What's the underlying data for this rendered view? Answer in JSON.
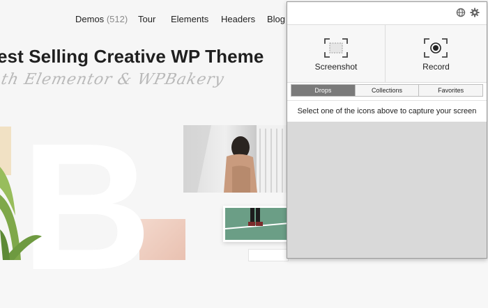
{
  "website": {
    "nav": {
      "demos_label": "Demos",
      "demos_count": "(512)",
      "tour": "Tour",
      "elements": "Elements",
      "headers": "Headers",
      "blog": "Blog"
    },
    "hero": {
      "title": "est Selling Creative WP Theme",
      "subtitle": "th Elementor & WPBakery",
      "big_letter": "B"
    }
  },
  "popup": {
    "header": {
      "globe_icon": "globe-icon",
      "settings_icon": "gear-icon"
    },
    "capture": {
      "screenshot_label": "Screenshot",
      "record_label": "Record"
    },
    "tabs": [
      {
        "label": "Drops",
        "active": true
      },
      {
        "label": "Collections",
        "active": false
      },
      {
        "label": "Favorites",
        "active": false
      }
    ],
    "message": "Select one of the icons above to capture your screen"
  },
  "colors": {
    "active_tab": "#7a7a7a",
    "drops_area": "#d9d9d9",
    "plant_green": "#7fa84a"
  }
}
